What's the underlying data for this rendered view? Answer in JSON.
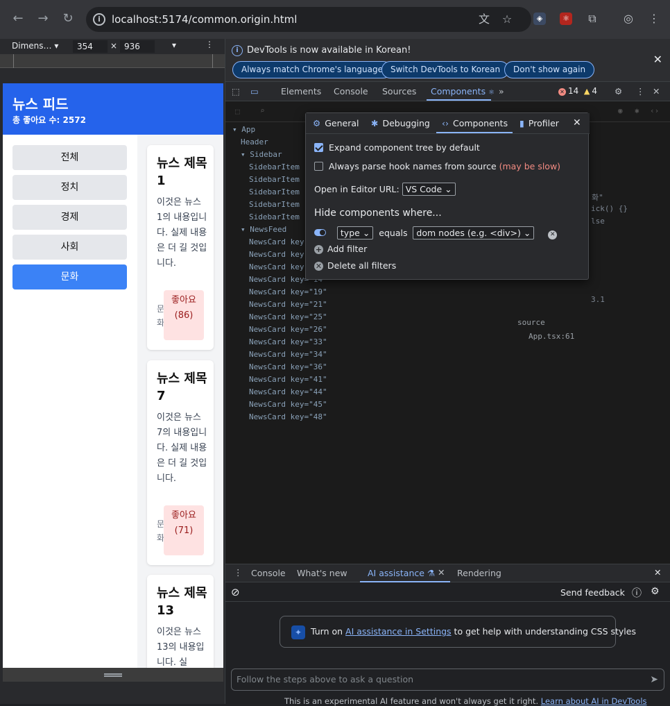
{
  "browser": {
    "url": "localhost:5174/common.origin.html",
    "icons": [
      "back-icon",
      "forward-icon",
      "reload-icon",
      "info-icon",
      "translate-icon",
      "star-icon",
      "extension-icon",
      "puzzle-icon",
      "profile-icon",
      "menu-icon"
    ]
  },
  "device": {
    "preset": "Dimens…",
    "width": "354",
    "times": "×",
    "height": "936"
  },
  "page": {
    "title": "뉴스 피드",
    "likes_total": "총 좋아요 수: 2572",
    "categories": [
      "전체",
      "정치",
      "경제",
      "사회",
      "문화"
    ],
    "active_category": "문화",
    "cards": [
      {
        "title": "뉴스 제목 1",
        "body": "이것은 뉴스 1의 내용입니다. 실제 내용은 더 길 것입니다.",
        "category": "문화",
        "like": "좋아요 (86)"
      },
      {
        "title": "뉴스 제목 7",
        "body": "이것은 뉴스 7의 내용입니다. 실제 내용은 더 길 것입니다.",
        "category": "문화",
        "like": "좋아요 (71)"
      },
      {
        "title": "뉴스 제목 13",
        "body": "이것은 뉴스 13의 내용입니다. 실",
        "category": "",
        "like": ""
      }
    ]
  },
  "devtools": {
    "infobar": {
      "text": "DevTools is now available in Korean!",
      "buttons": [
        "Always match Chrome's language",
        "Switch DevTools to Korean",
        "Don't show again"
      ]
    },
    "tabs": [
      "Elements",
      "Console",
      "Sources",
      "Components"
    ],
    "active_tab": "Components",
    "errors": "14",
    "warnings": "4",
    "tree": [
      {
        "indent": 0,
        "text": "▾ App"
      },
      {
        "indent": 1,
        "text": "Header"
      },
      {
        "indent": 1,
        "text": "▾ Sidebar"
      },
      {
        "indent": 2,
        "text": "SidebarItem"
      },
      {
        "indent": 2,
        "text": "SidebarItem"
      },
      {
        "indent": 2,
        "text": "SidebarItem"
      },
      {
        "indent": 2,
        "text": "SidebarItem"
      },
      {
        "indent": 2,
        "text": "SidebarItem"
      },
      {
        "indent": 1,
        "text": "▾ NewsFeed"
      },
      {
        "indent": 2,
        "text": "NewsCard key"
      },
      {
        "indent": 2,
        "text": "NewsCard key"
      },
      {
        "indent": 2,
        "text": "NewsCard key"
      },
      {
        "indent": 2,
        "text": "NewsCard key=\"14\""
      },
      {
        "indent": 2,
        "text": "NewsCard key=\"19\""
      },
      {
        "indent": 2,
        "text": "NewsCard key=\"21\""
      },
      {
        "indent": 2,
        "text": "NewsCard key=\"25\""
      },
      {
        "indent": 2,
        "text": "NewsCard key=\"26\""
      },
      {
        "indent": 2,
        "text": "NewsCard key=\"33\""
      },
      {
        "indent": 2,
        "text": "NewsCard key=\"34\""
      },
      {
        "indent": 2,
        "text": "NewsCard key=\"36\""
      },
      {
        "indent": 2,
        "text": "NewsCard key=\"41\""
      },
      {
        "indent": 2,
        "text": "NewsCard key=\"44\""
      },
      {
        "indent": 2,
        "text": "NewsCard key=\"45\""
      },
      {
        "indent": 2,
        "text": "NewsCard key=\"48\""
      }
    ],
    "right_panel": {
      "line1": "화\"",
      "line2": "ick() {}",
      "line3": "lse",
      "line4": "3.1",
      "source_label": "source",
      "source_value": "App.tsx:61"
    },
    "settings": {
      "tabs": [
        "General",
        "Debugging",
        "Components",
        "Profiler"
      ],
      "active_tab": "Components",
      "expand_label": "Expand component tree by default",
      "parse_label": "Always parse hook names from source",
      "parse_warning": "(may be slow)",
      "editor_label": "Open in Editor URL:",
      "editor_value": "VS Code",
      "hide_label": "Hide components where...",
      "filter_field": "type",
      "filter_op": "equals",
      "filter_value": "dom nodes (e.g. <div>)",
      "add_filter": "Add filter",
      "delete_filters": "Delete all filters"
    },
    "drawer": {
      "tabs": [
        "Console",
        "What's new",
        "AI assistance",
        "Rendering"
      ],
      "active_tab": "AI assistance",
      "send_feedback": "Send feedback",
      "ai_prefix": "Turn on ",
      "ai_link": "AI assistance in Settings",
      "ai_suffix": " to get help with understanding CSS styles",
      "ask_placeholder": "Follow the steps above to ask a question",
      "disclaimer_text": "This is an experimental AI feature and won't always get it right. ",
      "disclaimer_link": "Learn about AI in DevTools"
    }
  }
}
